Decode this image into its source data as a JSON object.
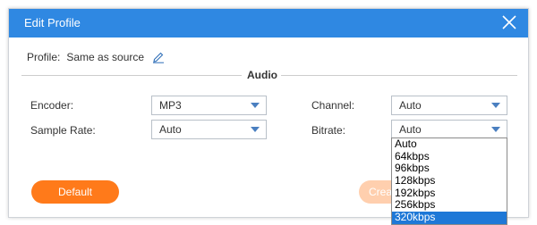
{
  "dialog": {
    "title": "Edit Profile",
    "close_icon": "close-icon"
  },
  "profile": {
    "label": "Profile:",
    "value": "Same as source",
    "edit_icon": "pencil-icon"
  },
  "section": {
    "title": "Audio"
  },
  "fields": {
    "encoder": {
      "label": "Encoder:",
      "value": "MP3"
    },
    "sample_rate": {
      "label": "Sample Rate:",
      "value": "Auto"
    },
    "channel": {
      "label": "Channel:",
      "value": "Auto"
    },
    "bitrate": {
      "label": "Bitrate:",
      "value": "Auto"
    }
  },
  "bitrate_options": [
    "Auto",
    "64kbps",
    "96kbps",
    "128kbps",
    "192kbps",
    "256kbps",
    "320kbps"
  ],
  "bitrate_highlighted": "320kbps",
  "buttons": {
    "default_label": "Default",
    "create_label": "Crea"
  },
  "colors": {
    "titlebar": "#2f88e2",
    "accent_orange": "#ff7a1a",
    "disabled_orange": "#ffcfae",
    "highlight": "#1e78d7"
  }
}
